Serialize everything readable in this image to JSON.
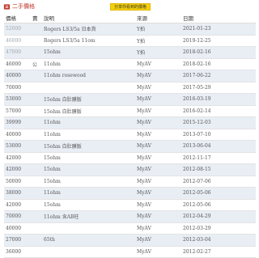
{
  "header": {
    "title": "二手價格",
    "share_button": "分享你看到的價格"
  },
  "table": {
    "columns": [
      "價格",
      "賣",
      "說明",
      "來源",
      "日期"
    ],
    "rows": [
      {
        "price": "52000",
        "flag": "",
        "desc": "Rogers LS3/5a 日本貨",
        "src": "Y拍",
        "date": "2021-01-23",
        "faded": true
      },
      {
        "price": "46000",
        "flag": "",
        "desc": "Rogers LS3/5a 11om",
        "src": "Y拍",
        "date": "2019-12-25",
        "faded": true
      },
      {
        "price": "47000",
        "flag": "",
        "desc": "15ohm",
        "src": "Y拍",
        "date": "2018-02-16",
        "faded": true
      },
      {
        "price": "46000",
        "flag": "公",
        "desc": "11ohm",
        "src": "MyAV",
        "date": "2018-02-16",
        "faded": false
      },
      {
        "price": "40000",
        "flag": "",
        "desc": "11ohm rosewood",
        "src": "MyAV",
        "date": "2017-06-22",
        "faded": false
      },
      {
        "price": "70000",
        "flag": "",
        "desc": "",
        "src": "MyAV",
        "date": "2017-05-29",
        "faded": false
      },
      {
        "price": "53000",
        "flag": "",
        "desc": "15ohm 白肚膜版",
        "src": "MyAV",
        "date": "2016-03-19",
        "faded": false
      },
      {
        "price": "57000",
        "flag": "",
        "desc": "15ohm 白肚膜版",
        "src": "MyAV",
        "date": "2016-02-14",
        "faded": false
      },
      {
        "price": "39999",
        "flag": "",
        "desc": "11ohm",
        "src": "MyAV",
        "date": "2015-12-03",
        "faded": false
      },
      {
        "price": "40000",
        "flag": "",
        "desc": "11ohm",
        "src": "MyAV",
        "date": "2013-07-10",
        "faded": false
      },
      {
        "price": "53000",
        "flag": "",
        "desc": "15ohm 白肚膜版",
        "src": "MyAV",
        "date": "2013-06-04",
        "faded": false
      },
      {
        "price": "42000",
        "flag": "",
        "desc": "15ohm",
        "src": "MyAV",
        "date": "2012-11-17",
        "faded": false
      },
      {
        "price": "42000",
        "flag": "",
        "desc": "15ohm",
        "src": "MyAV",
        "date": "2012-08-15",
        "faded": false
      },
      {
        "price": "50000",
        "flag": "",
        "desc": "15ohm",
        "src": "MyAV",
        "date": "2012-07-06",
        "faded": false
      },
      {
        "price": "38000",
        "flag": "",
        "desc": "11ohm",
        "src": "MyAV",
        "date": "2012-05-06",
        "faded": false
      },
      {
        "price": "42000",
        "flag": "",
        "desc": "15ohm",
        "src": "MyAV",
        "date": "2012-05-06",
        "faded": false
      },
      {
        "price": "70000",
        "flag": "",
        "desc": "11ohm 含AB柱",
        "src": "MyAV",
        "date": "2012-04-29",
        "faded": false
      },
      {
        "price": "40000",
        "flag": "",
        "desc": "",
        "src": "MyAV",
        "date": "2012-03-29",
        "faded": false
      },
      {
        "price": "27000",
        "flag": "",
        "desc": "65th",
        "src": "MyAV",
        "date": "2012-03-04",
        "faded": false
      },
      {
        "price": "36000",
        "flag": "",
        "desc": "",
        "src": "MyAV",
        "date": "2012-02-27",
        "faded": false
      }
    ]
  },
  "colors": {
    "title": "#c0392b",
    "button": "#f5d10a",
    "row_alt": "#e9eef5",
    "faded_text": "#a0a6ae"
  },
  "icons": {
    "title_icon": "tag-icon"
  }
}
